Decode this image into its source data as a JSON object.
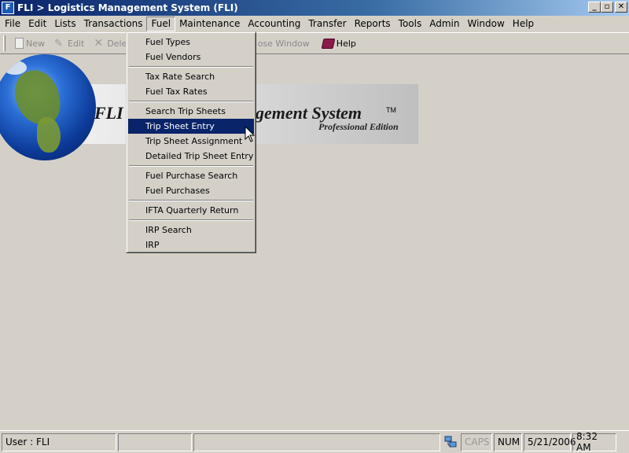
{
  "window": {
    "title": "FLI > Logistics Management System (FLI)",
    "icon_letter": "F",
    "controls": [
      "_",
      "▫",
      "✕"
    ]
  },
  "menubar": {
    "items": [
      "File",
      "Edit",
      "Lists",
      "Transactions",
      "Fuel",
      "Maintenance",
      "Accounting",
      "Transfer",
      "Reports",
      "Tools",
      "Admin",
      "Window",
      "Help"
    ],
    "open_item": "Fuel"
  },
  "toolbar": {
    "new_label": "New",
    "edit_label": "Edit",
    "delete_label": "Delet",
    "close_window_label": "ose Window",
    "help_label": "Help"
  },
  "banner": {
    "title_left": "FLI",
    "title_right": "gement System",
    "trademark": "TM",
    "edition": "Professional Edition"
  },
  "fuel_menu": {
    "items": [
      {
        "label": "Fuel Types"
      },
      {
        "label": "Fuel Vendors"
      },
      {
        "separator": true
      },
      {
        "label": "Tax Rate Search"
      },
      {
        "label": "Fuel Tax Rates"
      },
      {
        "separator": true
      },
      {
        "label": "Search Trip Sheets"
      },
      {
        "label": "Trip Sheet Entry",
        "highlighted": true
      },
      {
        "label": "Trip Sheet Assignment"
      },
      {
        "label": "Detailed Trip Sheet Entry"
      },
      {
        "separator": true
      },
      {
        "label": "Fuel Purchase Search"
      },
      {
        "label": "Fuel Purchases"
      },
      {
        "separator": true
      },
      {
        "label": "IFTA Quarterly Return"
      },
      {
        "separator": true
      },
      {
        "label": "IRP Search"
      },
      {
        "label": "IRP"
      }
    ]
  },
  "statusbar": {
    "user": "User : FLI",
    "pane2": "",
    "pane3": "",
    "caps": "CAPS",
    "num": "NUM",
    "date": "5/21/2006",
    "time": "8:32 AM"
  },
  "colors": {
    "title_gradient_start": "#0a246a",
    "menu_highlight": "#0a246a",
    "chrome": "#d4d0c8"
  }
}
